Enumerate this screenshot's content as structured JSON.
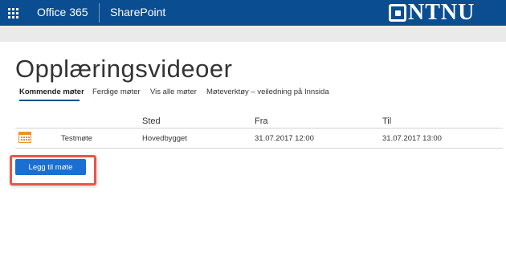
{
  "header": {
    "app_name": "Office 365",
    "site_name": "SharePoint",
    "logo_text": "NTNU",
    "bar_color": "#0a4d91"
  },
  "page": {
    "title": "Opplæringsvideoer"
  },
  "tabs": [
    {
      "label": "Kommende møter",
      "active": true
    },
    {
      "label": "Ferdige møter",
      "active": false
    },
    {
      "label": "Vis alle møter",
      "active": false
    },
    {
      "label": "Møteverktøy – veiledning på Innsida",
      "active": false
    }
  ],
  "table": {
    "columns": [
      "",
      "Sted",
      "Fra",
      "Til"
    ],
    "rows": [
      {
        "icon": "calendar-icon",
        "title": "Testmøte",
        "location": "Hovedbygget",
        "from": "31.07.2017 12:00",
        "to": "31.07.2017 13:00"
      }
    ]
  },
  "actions": {
    "add_meeting_label": "Legg til møte",
    "button_color": "#1a6fd1",
    "highlight_color": "#e8564a"
  }
}
